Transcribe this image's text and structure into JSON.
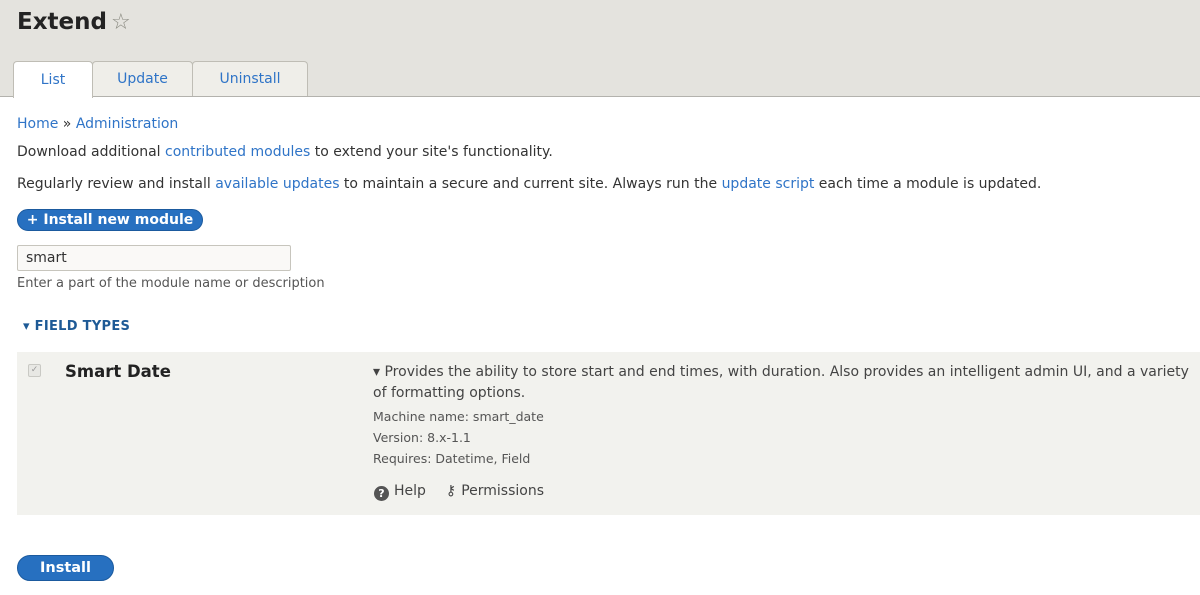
{
  "page": {
    "title": "Extend",
    "star_icon": "star-outline-icon"
  },
  "tabs": [
    {
      "label": "List",
      "active": true
    },
    {
      "label": "Update",
      "active": false
    },
    {
      "label": "Uninstall",
      "active": false
    }
  ],
  "breadcrumb": {
    "home": "Home",
    "separator": "»",
    "admin": "Administration"
  },
  "intro": {
    "p1_before": "Download additional ",
    "p1_link": "contributed modules",
    "p1_after": " to extend your site's functionality.",
    "p2_before": "Regularly review and install ",
    "p2_link1": "available updates",
    "p2_middle": " to maintain a secure and current site. Always run the ",
    "p2_link2": "update script",
    "p2_after": " each time a module is updated."
  },
  "install_new_label": "+ Install new module",
  "filter": {
    "value": "smart",
    "hint": "Enter a part of the module name or description"
  },
  "group": {
    "label": "▾ FIELD TYPES"
  },
  "module": {
    "name": "Smart Date",
    "checked": true,
    "description": "▾ Provides the ability to store start and end times, with duration. Also provides an intelligent admin UI, and a variety of formatting options.",
    "machine_name": "Machine name: smart_date",
    "version": "Version: 8.x-1.1",
    "requires": "Requires: Datetime, Field",
    "help_label": "Help",
    "permissions_label": "Permissions"
  },
  "install_label": "Install",
  "colors": {
    "link": "#2f74c7",
    "button": "#2770c0",
    "header_bg": "#e4e3de"
  }
}
